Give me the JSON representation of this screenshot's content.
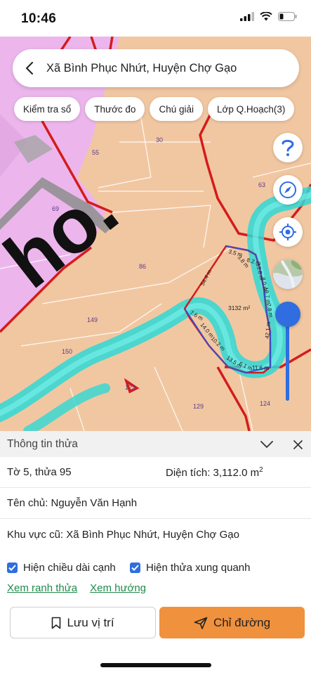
{
  "status_bar": {
    "time": "10:46"
  },
  "search": {
    "title": "Xã Bình Phục Nhứt, Huyện Chợ Gạo"
  },
  "chips": [
    "Kiểm tra sổ",
    "Thước đo",
    "Chú giải",
    "Lớp Q.Hoạch(3)"
  ],
  "map": {
    "parcel_labels": {
      "p30": "30",
      "p55": "55",
      "p69": "69",
      "p86": "86",
      "p63": "63",
      "p149": "149",
      "p150": "150",
      "p123": "123",
      "p129": "129",
      "p124": "124"
    },
    "area_label": "3132 m²",
    "edge_labels": {
      "e1": "3.5 m",
      "e2": "3.8 m",
      "e3": "8.2 m",
      "e4": "13.8 m",
      "e5": "8.0 m",
      "e6": "18.7 m",
      "e7": "7.8 m",
      "e8": "42.1 m",
      "e9": "11.6 m",
      "e10": "13.5 m",
      "e11": "6.1 m",
      "e12": "10.2 m",
      "e13": "14.0 m",
      "e14": "7.6 m",
      "e15": "54.4 m"
    },
    "background_text": "ho."
  },
  "sheet": {
    "title": "Thông tin thửa",
    "row1_left": "Tờ 5, thửa 95",
    "row1_right_prefix": "Diện tích: 3,112.0 m",
    "row1_right_sup": "2",
    "owner": "Tên chủ: Nguyễn Văn Hạnh",
    "old_area": "Khu vực cũ: Xã Bình Phục Nhứt, Huyện Chợ Gạo",
    "check1": "Hiện chiều dài cạnh",
    "check2": "Hiện thửa xung quanh",
    "link1": "Xem ranh thửa",
    "link2": "Xem hướng"
  },
  "buttons": {
    "save": "Lưu vị trí",
    "directions": "Chỉ đường"
  },
  "colors": {
    "parcel_fill": "#f1c7a2",
    "zone_pink": "#ecb6ec",
    "river": "#2fd8d6",
    "boundary_red": "#d41c1c",
    "accent_blue": "#2f6de1",
    "direction_orange": "#f0913d",
    "link_green": "#1f8a4a"
  }
}
